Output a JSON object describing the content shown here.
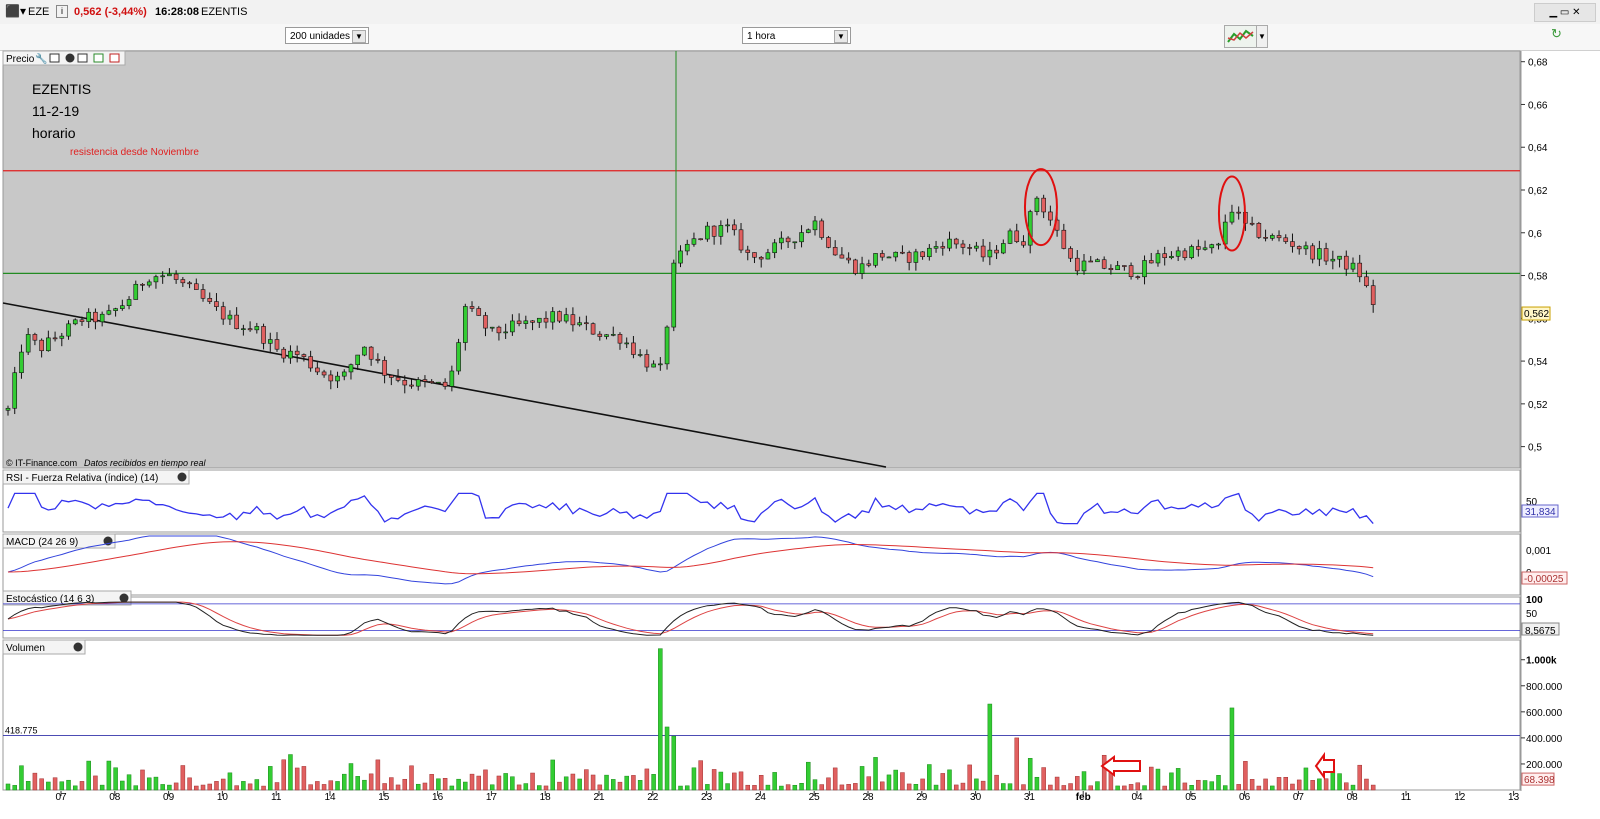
{
  "header": {
    "symbol": "EZE",
    "price_change": "0,562 (-3,44%)",
    "time": "16:28:08",
    "name": "EZENTIS"
  },
  "controls": {
    "units": "200 unidades",
    "interval": "1 hora"
  },
  "annotations": {
    "title_lines": [
      "EZENTIS",
      "11-2-19",
      "horario"
    ],
    "resistance": "resistencia desde Noviembre",
    "credit": "© IT-Finance.com",
    "credit_sub": "Datos recibidos en tiempo real"
  },
  "colors": {
    "up": "#33cc33",
    "down": "#e06060",
    "panel_bg": "#c8c8c8",
    "resistance": "#e02020",
    "support": "#228b22",
    "rsi": "#3333ee"
  },
  "chart_data": [
    {
      "panel": "Precio",
      "type": "candlestick",
      "x_date_labels": [
        "07",
        "08",
        "09",
        "10",
        "11",
        "14",
        "15",
        "16",
        "17",
        "18",
        "21",
        "22",
        "23",
        "24",
        "25",
        "28",
        "29",
        "30",
        "31",
        "feb",
        "04",
        "05",
        "06",
        "07",
        "08",
        "11",
        "12",
        "13"
      ],
      "y_ticks": [
        "0,68",
        "0,66",
        "0,64",
        "0,62",
        "0,6",
        "0,58",
        "0,56",
        "0,54",
        "0,52",
        "0,5"
      ],
      "ylim": [
        0.49,
        0.685
      ],
      "resistance_level": 0.629,
      "support_level": 0.581,
      "last_price_label": "0,562",
      "close_path": [
        [
          0,
          0.517
        ],
        [
          0.3,
          0.552
        ],
        [
          0.6,
          0.546
        ],
        [
          1.0,
          0.553
        ],
        [
          1.4,
          0.56
        ],
        [
          1.8,
          0.56
        ],
        [
          2.2,
          0.568
        ],
        [
          2.6,
          0.58
        ],
        [
          3.0,
          0.58
        ],
        [
          3.4,
          0.573
        ],
        [
          3.8,
          0.565
        ],
        [
          4.2,
          0.558
        ],
        [
          4.6,
          0.555
        ],
        [
          5.0,
          0.545
        ],
        [
          5.4,
          0.543
        ],
        [
          5.8,
          0.535
        ],
        [
          6.2,
          0.531
        ],
        [
          6.6,
          0.548
        ],
        [
          7.0,
          0.535
        ],
        [
          7.4,
          0.53
        ],
        [
          7.8,
          0.529
        ],
        [
          8.2,
          0.528
        ],
        [
          8.5,
          0.565
        ],
        [
          9.0,
          0.553
        ],
        [
          9.4,
          0.556
        ],
        [
          9.8,
          0.558
        ],
        [
          10.2,
          0.561
        ],
        [
          10.6,
          0.557
        ],
        [
          11.0,
          0.553
        ],
        [
          11.4,
          0.551
        ],
        [
          11.8,
          0.541
        ],
        [
          12.0,
          0.537
        ],
        [
          12.2,
          0.535
        ],
        [
          12.3,
          0.58
        ],
        [
          12.6,
          0.593
        ],
        [
          13.0,
          0.601
        ],
        [
          13.4,
          0.602
        ],
        [
          13.8,
          0.588
        ],
        [
          14.2,
          0.592
        ],
        [
          14.6,
          0.598
        ],
        [
          15.0,
          0.605
        ],
        [
          15.4,
          0.59
        ],
        [
          15.8,
          0.583
        ],
        [
          16.2,
          0.59
        ],
        [
          16.6,
          0.588
        ],
        [
          17.0,
          0.59
        ],
        [
          17.4,
          0.596
        ],
        [
          17.8,
          0.594
        ],
        [
          18.2,
          0.588
        ],
        [
          18.6,
          0.599
        ],
        [
          18.9,
          0.597
        ],
        [
          19.1,
          0.618
        ],
        [
          19.4,
          0.605
        ],
        [
          19.8,
          0.585
        ],
        [
          20.2,
          0.585
        ],
        [
          20.6,
          0.583
        ],
        [
          21.0,
          0.582
        ],
        [
          21.4,
          0.589
        ],
        [
          21.8,
          0.591
        ],
        [
          22.2,
          0.592
        ],
        [
          22.5,
          0.593
        ],
        [
          22.7,
          0.613
        ],
        [
          23.0,
          0.603
        ],
        [
          23.4,
          0.598
        ],
        [
          23.8,
          0.596
        ],
        [
          24.2,
          0.591
        ],
        [
          24.6,
          0.588
        ],
        [
          24.9,
          0.585
        ],
        [
          25.1,
          0.582
        ],
        [
          25.4,
          0.566
        ]
      ]
    },
    {
      "panel": "RSI",
      "type": "line",
      "title": "RSI - Fuerza Relativa (índice) (14)",
      "y_ticks": [
        "50"
      ],
      "last_value_label": "31,834"
    },
    {
      "panel": "MACD",
      "type": "line",
      "title": "MACD (24 26 9)",
      "y_ticks": [
        "0,001",
        "0"
      ],
      "last_value_label": "-0,00025"
    },
    {
      "panel": "Estocastico",
      "type": "line",
      "title": "Estocástico (14 6 3)",
      "y_ticks": [
        "100",
        "50"
      ],
      "last_value_label": "8,5675"
    },
    {
      "panel": "Volumen",
      "type": "bar",
      "title": "Volumen",
      "y_ticks": [
        "1.000k",
        "800.000",
        "600.000",
        "400.000",
        "200.000"
      ],
      "ylim": [
        0,
        1090000
      ],
      "reference_level": 418775,
      "reference_label": "418.775",
      "last_value_label": "68.398",
      "highlighted_bars": [
        {
          "x": 12.1,
          "value": 1085000,
          "color": "up"
        },
        {
          "x": 18.2,
          "value": 660000,
          "color": "up"
        },
        {
          "x": 18.7,
          "value": 400000,
          "color": "down"
        },
        {
          "x": 22.7,
          "value": 630000,
          "color": "up"
        }
      ]
    }
  ]
}
